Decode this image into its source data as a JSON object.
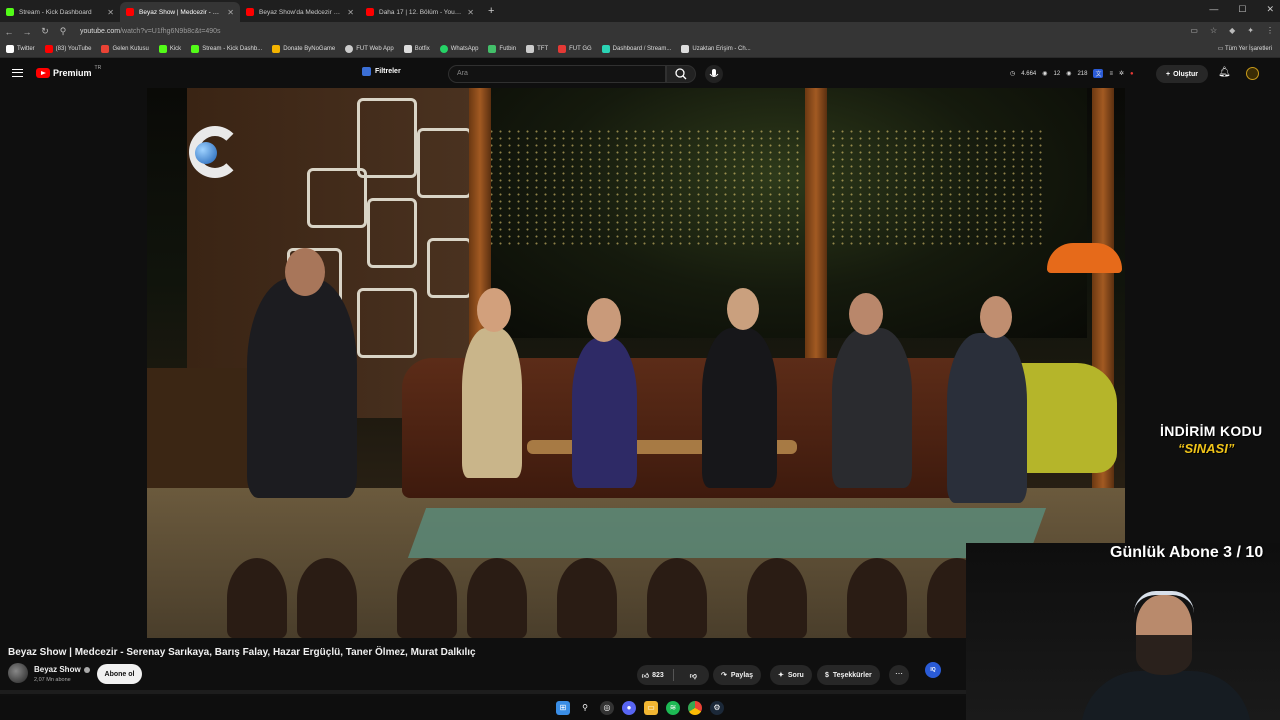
{
  "browser": {
    "tabs": [
      {
        "title": "Stream - Kick Dashboard",
        "fav_color": "#53fc18",
        "active": false
      },
      {
        "title": "Beyaz Show | Medcezir - Se...",
        "fav_color": "#ff0000",
        "active": true
      },
      {
        "title": "Beyaz Show'da Medcezir skeç...",
        "fav_color": "#ff0000",
        "active": false
      },
      {
        "title": "Daha 17 | 12. Bölüm - YouTube",
        "fav_color": "#ff0000",
        "active": false
      }
    ],
    "url_host": "youtube.com",
    "url_path": "/watch?v=U1fhg6N9b8c&t=490s",
    "bookmarks": [
      {
        "label": "Twitter",
        "color": "#ffffff"
      },
      {
        "label": "(83) YouTube",
        "color": "#ff0000"
      },
      {
        "label": "Gelen Kutusu",
        "color": "#ea4335"
      },
      {
        "label": "Kick",
        "color": "#53fc18"
      },
      {
        "label": "Stream - Kick Dashb...",
        "color": "#53fc18"
      },
      {
        "label": "Donate ByNoGame",
        "color": "#f4b400"
      },
      {
        "label": "FUT Web App",
        "color": "#cccccc"
      },
      {
        "label": "Botfix",
        "color": "#dddddd"
      },
      {
        "label": "WhatsApp",
        "color": "#25d366"
      },
      {
        "label": "Futbin",
        "color": "#43c06a"
      },
      {
        "label": "TFT",
        "color": "#cccccc"
      },
      {
        "label": "FUT GG",
        "color": "#e53935"
      },
      {
        "label": "Dashboard / Stream...",
        "color": "#2bd4b5"
      },
      {
        "label": "Uzaktan Erişim - Ch...",
        "color": "#dddddd"
      }
    ],
    "all_bookmarks": "Tüm Yer İşaretleri"
  },
  "youtube": {
    "logo_word": "Premium",
    "logo_region": "TR",
    "filters_label": "Filtreler",
    "search_placeholder": "Ara",
    "stats": {
      "views": "4.664",
      "a": "12",
      "b": "218"
    },
    "create_label": "Oluştur",
    "video_title": "Beyaz Show | Medcezir - Serenay Sarıkaya, Barış Falay, Hazar Ergüçlü, Taner Ölmez, Murat Dalkılıç",
    "channel_name": "Beyaz Show",
    "subscribers": "2,07 Mn abone",
    "subscribe_label": "Abone ol",
    "likes": "823",
    "share_label": "Paylaş",
    "ask_label": "Soru",
    "thanks_label": "Teşekkürler",
    "iq_label": "IQ"
  },
  "overlay": {
    "promo_line1": "İNDİRİM KODU",
    "promo_line2": "“SINASI”",
    "sub_goal": "Günlük Abone 3 / 10"
  },
  "icons": {
    "accent": "#ff0000",
    "promo_color": "#f0c419"
  }
}
